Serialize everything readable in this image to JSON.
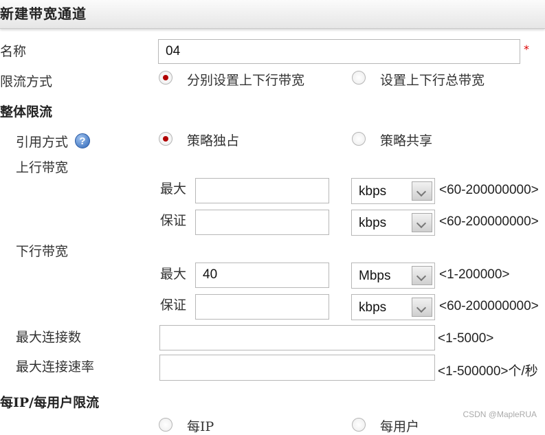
{
  "dialog": {
    "title": "新建带宽通道"
  },
  "form": {
    "name": {
      "label": "名称",
      "value": "04",
      "required_mark": "*"
    },
    "limit_mode": {
      "label": "限流方式",
      "options": [
        {
          "label": "分别设置上下行带宽",
          "selected": true
        },
        {
          "label": "设置上下行总带宽",
          "selected": false
        }
      ]
    },
    "overall": {
      "section_label": "整体限流",
      "ref_mode": {
        "label": "引用方式",
        "help_icon": "help-icon",
        "options": [
          {
            "label": "策略独占",
            "selected": true
          },
          {
            "label": "策略共享",
            "selected": false
          }
        ]
      },
      "upstream": {
        "label": "上行带宽",
        "max": {
          "label": "最大",
          "value": "",
          "unit": "kbps",
          "range": "<60-200000000>"
        },
        "guarantee": {
          "label": "保证",
          "value": "",
          "unit": "kbps",
          "range": "<60-200000000>"
        }
      },
      "downstream": {
        "label": "下行带宽",
        "max": {
          "label": "最大",
          "value": "40",
          "unit": "Mbps",
          "range": "<1-200000>"
        },
        "guarantee": {
          "label": "保证",
          "value": "",
          "unit": "kbps",
          "range": "<60-200000000>"
        }
      },
      "max_connections": {
        "label": "最大连接数",
        "value": "",
        "range": "<1-5000>"
      },
      "max_conn_rate": {
        "label": "最大连接速率",
        "value": "",
        "range": "<1-500000>个/秒"
      }
    },
    "per_ip": {
      "section_label": "每IP/每用户限流",
      "options": [
        {
          "label": "每IP",
          "selected": false
        },
        {
          "label": "每用户",
          "selected": false
        }
      ]
    }
  },
  "watermark": "CSDN @MapleRUA"
}
